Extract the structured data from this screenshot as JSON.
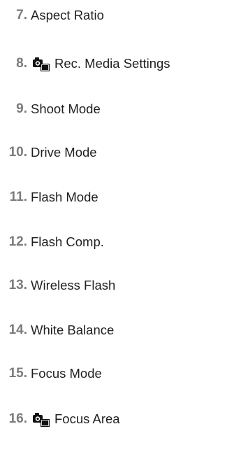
{
  "items": [
    {
      "number": "7.",
      "label": "Aspect Ratio",
      "icon": null
    },
    {
      "number": "8.",
      "label": "Rec. Media Settings",
      "icon": "camera-video-icon"
    },
    {
      "number": "9.",
      "label": "Shoot Mode",
      "icon": null
    },
    {
      "number": "10.",
      "label": "Drive Mode",
      "icon": null
    },
    {
      "number": "11.",
      "label": "Flash Mode",
      "icon": null
    },
    {
      "number": "12.",
      "label": "Flash Comp.",
      "icon": null
    },
    {
      "number": "13.",
      "label": "Wireless Flash",
      "icon": null
    },
    {
      "number": "14.",
      "label": "White Balance",
      "icon": null
    },
    {
      "number": "15.",
      "label": "Focus Mode",
      "icon": null
    },
    {
      "number": "16.",
      "label": "Focus Area",
      "icon": "camera-video-icon"
    }
  ]
}
